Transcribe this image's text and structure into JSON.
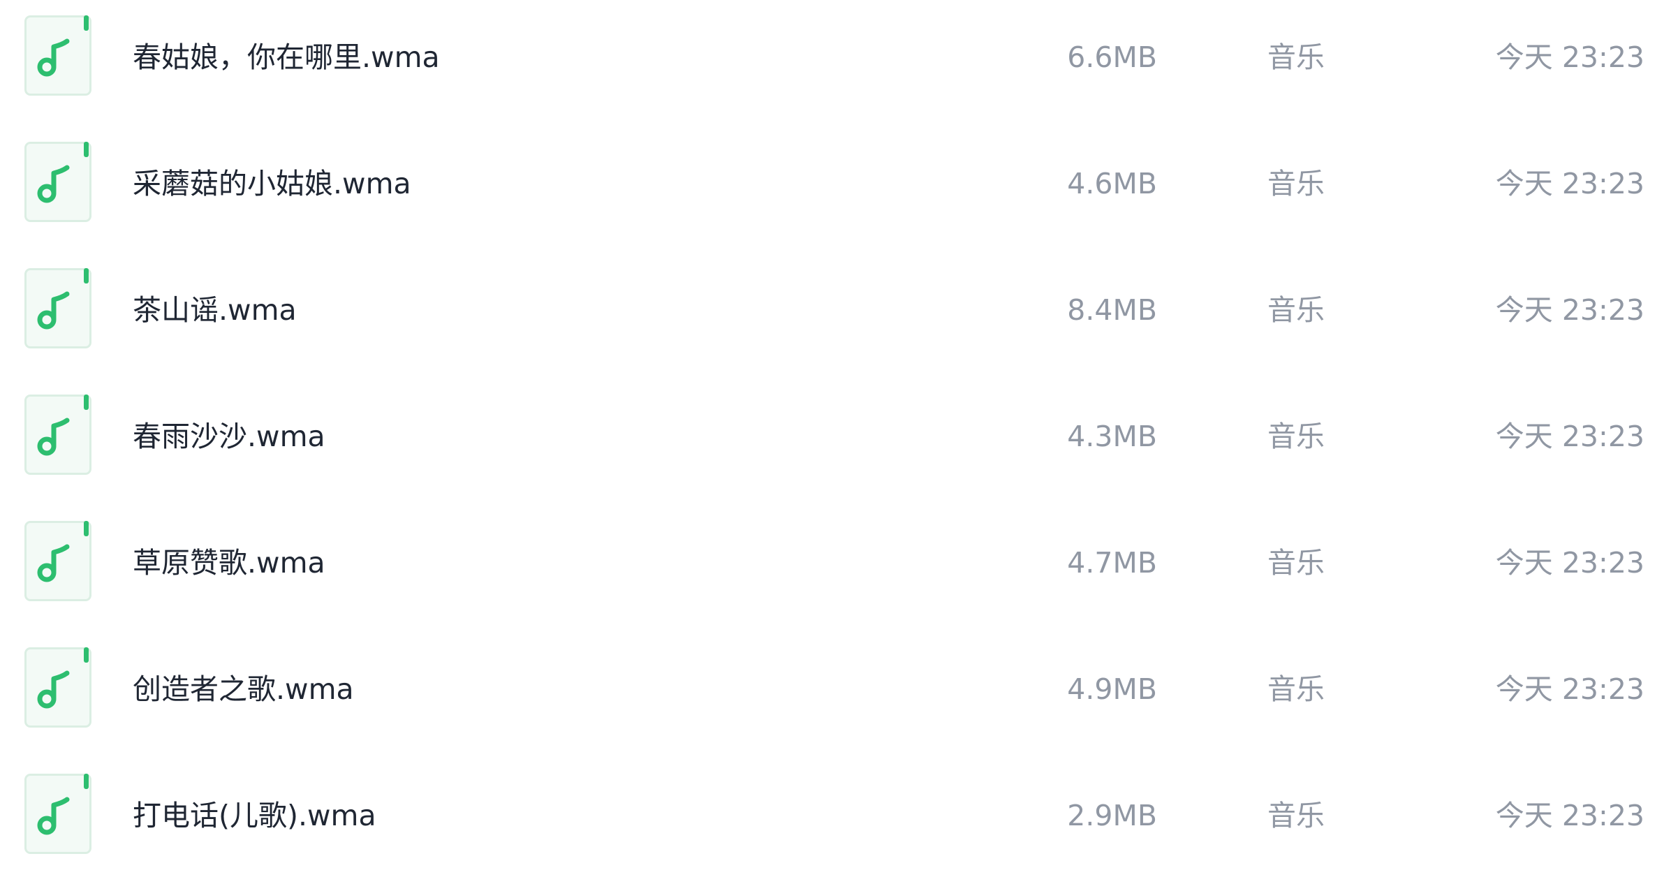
{
  "colors": {
    "accent": "#2dbe6f",
    "icon_bg": "#f3faf6",
    "icon_border": "#dbeee3",
    "name_text": "#1f2633",
    "meta_text": "#9097a3"
  },
  "files": [
    {
      "name": "春姑娘，你在哪里.wma",
      "size": "6.6MB",
      "type": "音乐",
      "time": "今天 23:23",
      "icon": "music-file-icon"
    },
    {
      "name": "采蘑菇的小姑娘.wma",
      "size": "4.6MB",
      "type": "音乐",
      "time": "今天 23:23",
      "icon": "music-file-icon"
    },
    {
      "name": "茶山谣.wma",
      "size": "8.4MB",
      "type": "音乐",
      "time": "今天 23:23",
      "icon": "music-file-icon"
    },
    {
      "name": "春雨沙沙.wma",
      "size": "4.3MB",
      "type": "音乐",
      "time": "今天 23:23",
      "icon": "music-file-icon"
    },
    {
      "name": "草原赞歌.wma",
      "size": "4.7MB",
      "type": "音乐",
      "time": "今天 23:23",
      "icon": "music-file-icon"
    },
    {
      "name": "创造者之歌.wma",
      "size": "4.9MB",
      "type": "音乐",
      "time": "今天 23:23",
      "icon": "music-file-icon"
    },
    {
      "name": "打电话(儿歌).wma",
      "size": "2.9MB",
      "type": "音乐",
      "time": "今天 23:23",
      "icon": "music-file-icon"
    }
  ]
}
